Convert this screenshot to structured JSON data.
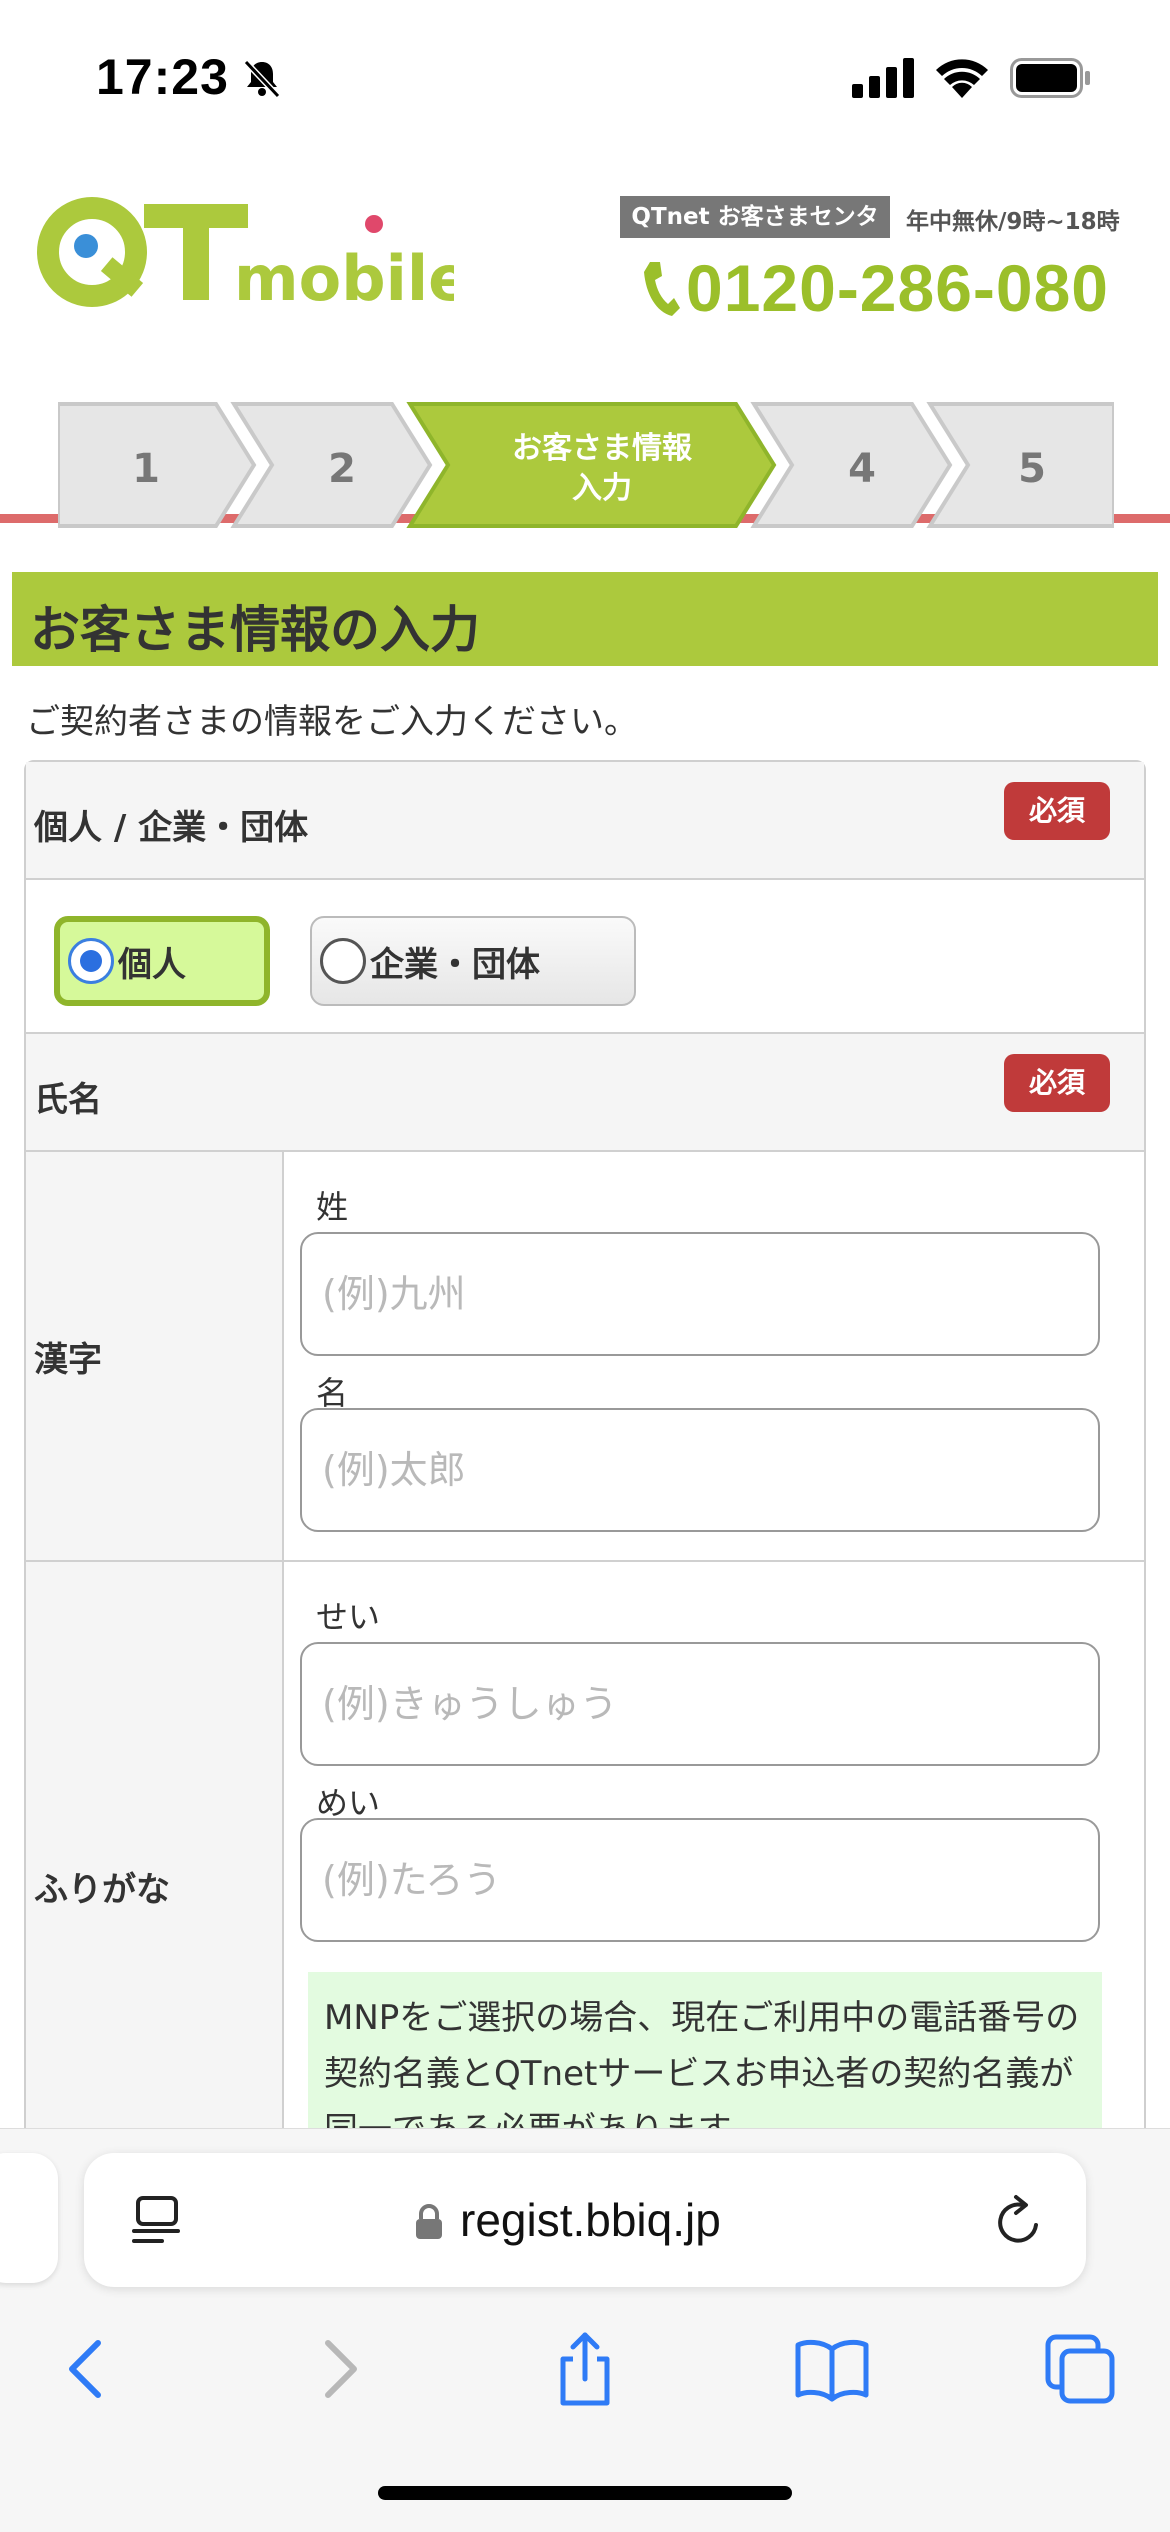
{
  "status_bar": {
    "time": "17:23"
  },
  "header": {
    "logo_text": "QTmobile",
    "center_label": "QTnet お客さまセンター",
    "hours": "年中無休/9時~18時",
    "phone": "0120-286-080"
  },
  "steps": [
    {
      "label": "1",
      "active": false
    },
    {
      "label": "2",
      "active": false
    },
    {
      "label": "お客さま情報",
      "label2": "入力",
      "active": true
    },
    {
      "label": "4",
      "active": false
    },
    {
      "label": "5",
      "active": false
    }
  ],
  "section": {
    "title": "お客さま情報の入力",
    "intro": "ご契約者さまの情報をご入力ください。"
  },
  "form": {
    "required_label": "必須",
    "type_row": {
      "label": "個人 / 企業・団体",
      "options": [
        {
          "label": "個人",
          "selected": true
        },
        {
          "label": "企業・団体",
          "selected": false
        }
      ]
    },
    "name_row": {
      "label": "氏名"
    },
    "kanji": {
      "label": "漢字",
      "sei_label": "姓",
      "sei_placeholder": "(例)九州",
      "mei_label": "名",
      "mei_placeholder": "(例)太郎"
    },
    "furigana": {
      "label": "ふりがな",
      "sei_label": "せい",
      "sei_placeholder": "(例)きゅうしゅう",
      "mei_label": "めい",
      "mei_placeholder": "(例)たろう",
      "note": "MNPをご選択の場合、現在ご利用中の電話番号の契約名義とQTnetサービスお申込者の契約名義が同一である必要があります。"
    }
  },
  "browser": {
    "url": "regist.bbiq.jp"
  },
  "colors": {
    "accent_green": "#acc93d",
    "required_red": "#c03a3a",
    "header_rule": "#dd6b6b",
    "ios_blue": "#2f7bf6"
  }
}
